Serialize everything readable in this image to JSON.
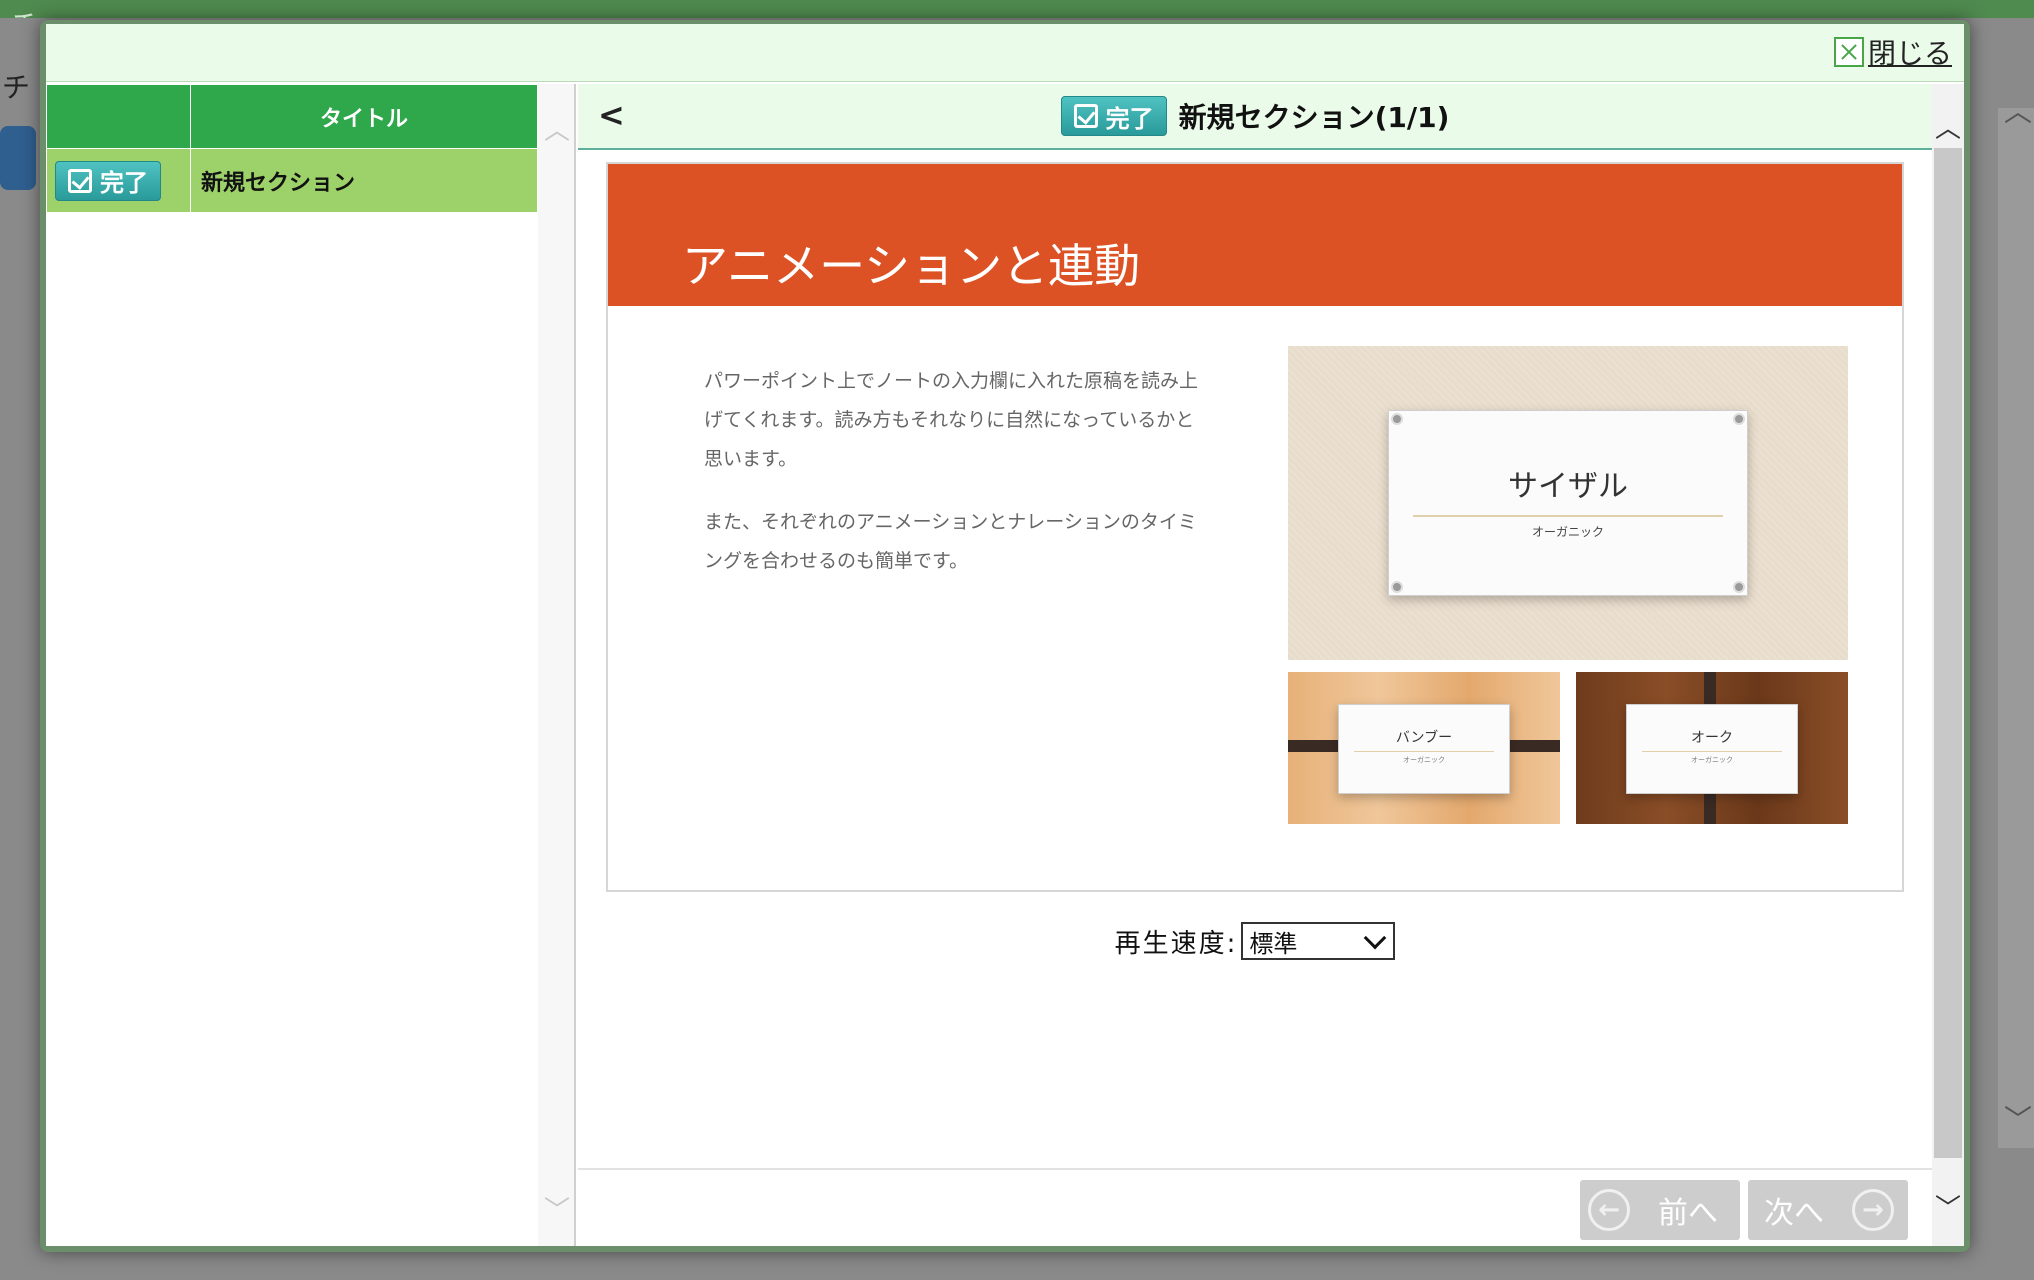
{
  "background": {
    "title": "チ",
    "label": "チ"
  },
  "modal": {
    "close_label": "閉じる"
  },
  "toc": {
    "header_title": "タイトル",
    "rows": [
      {
        "status": "完了",
        "title": "新規セクション"
      }
    ]
  },
  "section": {
    "back_label": "<",
    "status": "完了",
    "title": "新規セクション(1/1)"
  },
  "slide": {
    "title": "アニメーションと連動",
    "paragraphs": [
      "パワーポイント上でノートの入力欄に入れた原稿を読み上げてくれます。読み方もそれなりに自然になっているかと思います。",
      "また、それぞれのアニメーションとナレーションのタイミングを合わせるのも簡単です。"
    ],
    "main_card": {
      "title": "サイザル",
      "subtitle": "オーガニック"
    },
    "bamboo_card": {
      "title": "バンブー",
      "subtitle": "オーガニック"
    },
    "oak_card": {
      "title": "オーク",
      "subtitle": "オーガニック"
    },
    "accent_color": "#dd5224"
  },
  "playback": {
    "label": "再生速度:",
    "selected": "標準"
  },
  "nav": {
    "prev_label": "前へ",
    "next_label": "次へ"
  },
  "colors": {
    "header_green": "#2ea84a",
    "row_green": "#9dd26a",
    "badge_teal": "#2a9a9a"
  }
}
